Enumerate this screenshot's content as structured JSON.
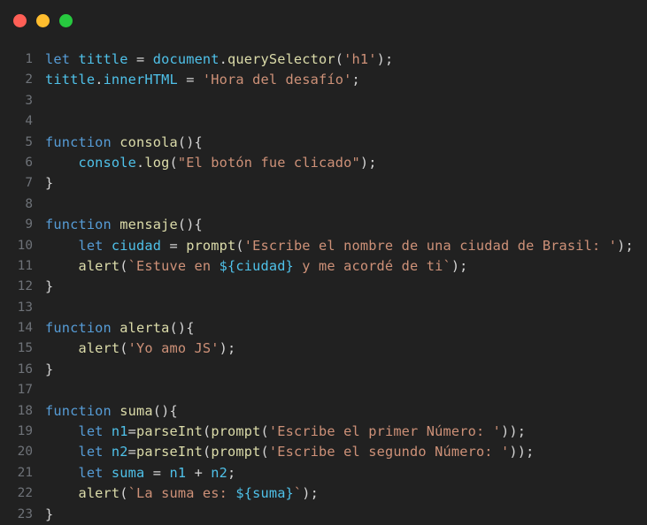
{
  "window": {
    "titlebar": {
      "buttons": [
        {
          "name": "close",
          "label": "",
          "color": "#ff5f56"
        },
        {
          "name": "minimize",
          "label": "",
          "color": "#ffbd2e"
        },
        {
          "name": "maximize",
          "label": "",
          "color": "#27c93f"
        }
      ]
    }
  },
  "theme": {
    "background": "#212121",
    "gutter_text": "#6e7278",
    "keyword": "#569cd6",
    "variable": "#4fc1e9",
    "function": "#dcdcaa",
    "string": "#ce9178",
    "punctuation": "#d4d4d4"
  },
  "editor": {
    "language": "javascript",
    "first_line_number": 1,
    "last_line_number": 23,
    "lines": [
      {
        "number": "1",
        "text": "let tittle = document.querySelector('h1');",
        "tokens": [
          {
            "t": "let",
            "c": "t-kw"
          },
          {
            "t": " ",
            "c": "t-plain"
          },
          {
            "t": "tittle",
            "c": "t-var"
          },
          {
            "t": " = ",
            "c": "t-punc"
          },
          {
            "t": "document",
            "c": "t-var"
          },
          {
            "t": ".",
            "c": "t-punc"
          },
          {
            "t": "querySelector",
            "c": "t-fn"
          },
          {
            "t": "(",
            "c": "t-punc"
          },
          {
            "t": "'h1'",
            "c": "t-str"
          },
          {
            "t": ");",
            "c": "t-punc"
          }
        ]
      },
      {
        "number": "2",
        "text": "tittle.innerHTML = 'Hora del desafío';",
        "tokens": [
          {
            "t": "tittle",
            "c": "t-var"
          },
          {
            "t": ".",
            "c": "t-punc"
          },
          {
            "t": "innerHTML",
            "c": "t-var"
          },
          {
            "t": " = ",
            "c": "t-punc"
          },
          {
            "t": "'Hora del desafío'",
            "c": "t-str"
          },
          {
            "t": ";",
            "c": "t-punc"
          }
        ]
      },
      {
        "number": "3",
        "text": "",
        "tokens": []
      },
      {
        "number": "4",
        "text": "",
        "tokens": []
      },
      {
        "number": "5",
        "text": "function consola(){",
        "tokens": [
          {
            "t": "function",
            "c": "t-kw"
          },
          {
            "t": " ",
            "c": "t-plain"
          },
          {
            "t": "consola",
            "c": "t-fn"
          },
          {
            "t": "(){",
            "c": "t-punc"
          }
        ]
      },
      {
        "number": "6",
        "text": "    console.log(\"El botón fue clicado\");",
        "tokens": [
          {
            "t": "    ",
            "c": "t-plain"
          },
          {
            "t": "console",
            "c": "t-var"
          },
          {
            "t": ".",
            "c": "t-punc"
          },
          {
            "t": "log",
            "c": "t-fn"
          },
          {
            "t": "(",
            "c": "t-punc"
          },
          {
            "t": "\"El botón fue clicado\"",
            "c": "t-str"
          },
          {
            "t": ");",
            "c": "t-punc"
          }
        ]
      },
      {
        "number": "7",
        "text": "}",
        "tokens": [
          {
            "t": "}",
            "c": "t-punc"
          }
        ]
      },
      {
        "number": "8",
        "text": "",
        "tokens": []
      },
      {
        "number": "9",
        "text": "function mensaje(){",
        "tokens": [
          {
            "t": "function",
            "c": "t-kw"
          },
          {
            "t": " ",
            "c": "t-plain"
          },
          {
            "t": "mensaje",
            "c": "t-fn"
          },
          {
            "t": "(){",
            "c": "t-punc"
          }
        ]
      },
      {
        "number": "10",
        "text": "    let ciudad = prompt('Escribe el nombre de una ciudad de Brasil: ');",
        "tokens": [
          {
            "t": "    ",
            "c": "t-plain"
          },
          {
            "t": "let",
            "c": "t-kw"
          },
          {
            "t": " ",
            "c": "t-plain"
          },
          {
            "t": "ciudad",
            "c": "t-var"
          },
          {
            "t": " = ",
            "c": "t-punc"
          },
          {
            "t": "prompt",
            "c": "t-fn"
          },
          {
            "t": "(",
            "c": "t-punc"
          },
          {
            "t": "'Escribe el nombre de una ciudad de Brasil: '",
            "c": "t-str"
          },
          {
            "t": ");",
            "c": "t-punc"
          }
        ]
      },
      {
        "number": "11",
        "text": "    alert(`Estuve en ${ciudad} y me acordé de ti`);",
        "tokens": [
          {
            "t": "    ",
            "c": "t-plain"
          },
          {
            "t": "alert",
            "c": "t-fn"
          },
          {
            "t": "(",
            "c": "t-punc"
          },
          {
            "t": "`Estuve en ",
            "c": "t-str"
          },
          {
            "t": "${ciudad}",
            "c": "t-var"
          },
          {
            "t": " y me acordé de ti`",
            "c": "t-str"
          },
          {
            "t": ");",
            "c": "t-punc"
          }
        ]
      },
      {
        "number": "12",
        "text": "}",
        "tokens": [
          {
            "t": "}",
            "c": "t-punc"
          }
        ]
      },
      {
        "number": "13",
        "text": "",
        "tokens": []
      },
      {
        "number": "14",
        "text": "function alerta(){",
        "tokens": [
          {
            "t": "function",
            "c": "t-kw"
          },
          {
            "t": " ",
            "c": "t-plain"
          },
          {
            "t": "alerta",
            "c": "t-fn"
          },
          {
            "t": "(){",
            "c": "t-punc"
          }
        ]
      },
      {
        "number": "15",
        "text": "    alert('Yo amo JS');",
        "tokens": [
          {
            "t": "    ",
            "c": "t-plain"
          },
          {
            "t": "alert",
            "c": "t-fn"
          },
          {
            "t": "(",
            "c": "t-punc"
          },
          {
            "t": "'Yo amo JS'",
            "c": "t-str"
          },
          {
            "t": ");",
            "c": "t-punc"
          }
        ]
      },
      {
        "number": "16",
        "text": "}",
        "tokens": [
          {
            "t": "}",
            "c": "t-punc"
          }
        ]
      },
      {
        "number": "17",
        "text": "",
        "tokens": []
      },
      {
        "number": "18",
        "text": "function suma(){",
        "tokens": [
          {
            "t": "function",
            "c": "t-kw"
          },
          {
            "t": " ",
            "c": "t-plain"
          },
          {
            "t": "suma",
            "c": "t-fn"
          },
          {
            "t": "(){",
            "c": "t-punc"
          }
        ]
      },
      {
        "number": "19",
        "text": "    let n1=parseInt(prompt('Escribe el primer Número: '));",
        "tokens": [
          {
            "t": "    ",
            "c": "t-plain"
          },
          {
            "t": "let",
            "c": "t-kw"
          },
          {
            "t": " ",
            "c": "t-plain"
          },
          {
            "t": "n1",
            "c": "t-var"
          },
          {
            "t": "=",
            "c": "t-punc"
          },
          {
            "t": "parseInt",
            "c": "t-fn"
          },
          {
            "t": "(",
            "c": "t-punc"
          },
          {
            "t": "prompt",
            "c": "t-fn"
          },
          {
            "t": "(",
            "c": "t-punc"
          },
          {
            "t": "'Escribe el primer Número: '",
            "c": "t-str"
          },
          {
            "t": "));",
            "c": "t-punc"
          }
        ]
      },
      {
        "number": "20",
        "text": "    let n2=parseInt(prompt('Escribe el segundo Número: '));",
        "tokens": [
          {
            "t": "    ",
            "c": "t-plain"
          },
          {
            "t": "let",
            "c": "t-kw"
          },
          {
            "t": " ",
            "c": "t-plain"
          },
          {
            "t": "n2",
            "c": "t-var"
          },
          {
            "t": "=",
            "c": "t-punc"
          },
          {
            "t": "parseInt",
            "c": "t-fn"
          },
          {
            "t": "(",
            "c": "t-punc"
          },
          {
            "t": "prompt",
            "c": "t-fn"
          },
          {
            "t": "(",
            "c": "t-punc"
          },
          {
            "t": "'Escribe el segundo Número: '",
            "c": "t-str"
          },
          {
            "t": "));",
            "c": "t-punc"
          }
        ]
      },
      {
        "number": "21",
        "text": "    let suma = n1 + n2;",
        "tokens": [
          {
            "t": "    ",
            "c": "t-plain"
          },
          {
            "t": "let",
            "c": "t-kw"
          },
          {
            "t": " ",
            "c": "t-plain"
          },
          {
            "t": "suma",
            "c": "t-var"
          },
          {
            "t": " = ",
            "c": "t-punc"
          },
          {
            "t": "n1",
            "c": "t-var"
          },
          {
            "t": " + ",
            "c": "t-punc"
          },
          {
            "t": "n2",
            "c": "t-var"
          },
          {
            "t": ";",
            "c": "t-punc"
          }
        ]
      },
      {
        "number": "22",
        "text": "    alert(`La suma es: ${suma}`);",
        "tokens": [
          {
            "t": "    ",
            "c": "t-plain"
          },
          {
            "t": "alert",
            "c": "t-fn"
          },
          {
            "t": "(",
            "c": "t-punc"
          },
          {
            "t": "`La suma es: ",
            "c": "t-str"
          },
          {
            "t": "${suma}",
            "c": "t-var"
          },
          {
            "t": "`",
            "c": "t-str"
          },
          {
            "t": ");",
            "c": "t-punc"
          }
        ]
      },
      {
        "number": "23",
        "text": "}",
        "tokens": [
          {
            "t": "}",
            "c": "t-punc"
          }
        ]
      }
    ]
  }
}
